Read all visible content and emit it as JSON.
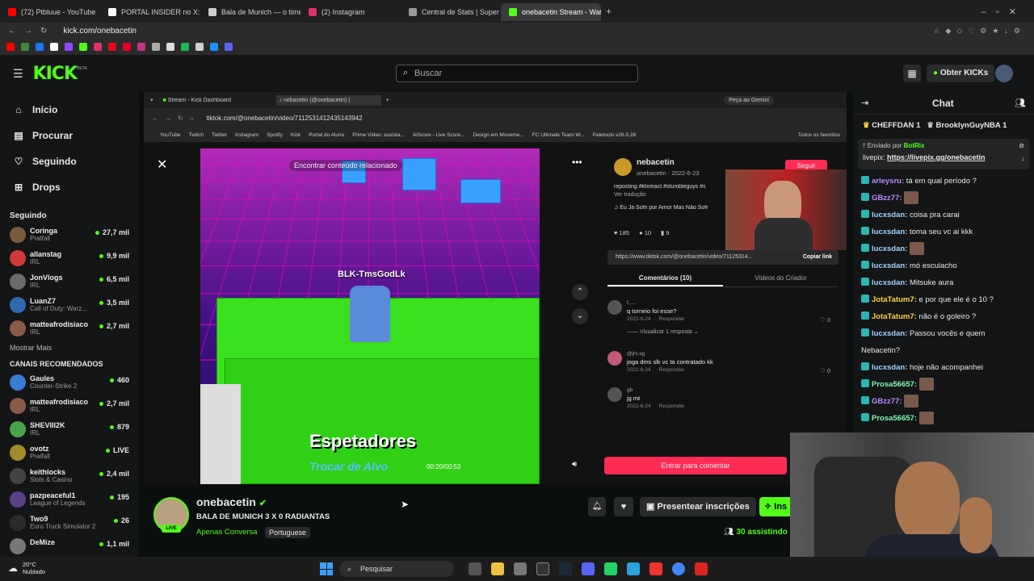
{
  "browser": {
    "tabs": [
      {
        "label": "(72) Ptbluue - YouTube",
        "color": "#ff0000"
      },
      {
        "label": "PORTAL INSIDER no X: \"",
        "color": "#ffffff"
      },
      {
        "label": "Bala de Munich — o time c",
        "color": "#cccccc"
      },
      {
        "label": "(2) Instagram",
        "color": "#e1306c"
      },
      {
        "label": "Central de Stats | Super Ce",
        "color": "#999999"
      },
      {
        "label": "onebacetin Stream - Watch",
        "color": "#53fc18"
      }
    ],
    "url": "kick.com/onebacetin"
  },
  "kick": {
    "logo": "KICK",
    "logo_beta": "BETA",
    "search_placeholder": "Buscar",
    "obtain_kicks": "Obter KICKs",
    "nav": [
      {
        "label": "Início",
        "icon": "home-icon"
      },
      {
        "label": "Procurar",
        "icon": "browse-icon"
      },
      {
        "label": "Seguindo",
        "icon": "heart-icon"
      },
      {
        "label": "Drops",
        "icon": "drops-icon"
      }
    ],
    "following_title": "Seguindo",
    "following": [
      {
        "name": "Coringa",
        "category": "Pratfall",
        "viewers": "27,7 mil",
        "color": "#7a5c3c"
      },
      {
        "name": "allanstag",
        "category": "IRL",
        "viewers": "9,9 mil",
        "color": "#d23a3a"
      },
      {
        "name": "JonVlogs",
        "category": "IRL",
        "viewers": "6,5 mil",
        "color": "#6b6b6b"
      },
      {
        "name": "LuanZ7",
        "category": "Call of Duty: Warz...",
        "viewers": "3,5 mil",
        "color": "#2f6ab0"
      },
      {
        "name": "matteafrodisiaco",
        "category": "IRL",
        "viewers": "2,7 mil",
        "color": "#8b5a4a"
      }
    ],
    "show_more": "Mostrar Mais",
    "recommended_title": "CANAIS RECOMENDADOS",
    "recommended": [
      {
        "name": "Gaules",
        "category": "Counter-Strike 2",
        "viewers": "460",
        "color": "#3a7bd5"
      },
      {
        "name": "matteafrodisiaco",
        "category": "IRL",
        "viewers": "2,7 mil",
        "color": "#8b5a4a"
      },
      {
        "name": "SHEVIII2K",
        "category": "IRL",
        "viewers": "879",
        "color": "#4aa34a"
      },
      {
        "name": "ovotz",
        "category": "Pratfall",
        "viewers": "LIVE",
        "color": "#a08a2a"
      },
      {
        "name": "keithlocks",
        "category": "Slots & Casino",
        "viewers": "2,4 mil",
        "color": "#444"
      },
      {
        "name": "pazpeaceful1",
        "category": "League of Legends",
        "viewers": "195",
        "color": "#5a3f8a"
      },
      {
        "name": "Two9",
        "category": "Euro Truck Simulator 2",
        "viewers": "26",
        "color": "#2b2b2b"
      },
      {
        "name": "DeMize",
        "category": "",
        "viewers": "1,1 mil",
        "color": "#777"
      }
    ]
  },
  "inner_browser": {
    "tabs": [
      "Stream - Kick Dashboard",
      "nebacetin (@onebacetin) |"
    ],
    "gemini": "Peça ao Gemini",
    "url": "tiktok.com/@onebacetin/video/7112531412435143942",
    "bookmarks": [
      "YouTube",
      "Twitch",
      "Twitter",
      "Instagram",
      "Spotify",
      "Kick",
      "Portal do Aluno",
      "Prime Video: assista...",
      "AiScore - Live Score...",
      "Design em Moveme...",
      "FC Ultimate Team W...",
      "Paletools v26.0.28"
    ],
    "all_favorites": "Todos os favoritos"
  },
  "tiktok": {
    "related": "Encontrar conteúdo relacionado",
    "gamer_tag": "BLK-TmsGodLk",
    "spectators": "Espetadores",
    "change_target": "Trocar de Alvo",
    "time": "00:20/00:53",
    "author": "nebacetin",
    "author_sub": "onebacetin · 2022-6-23",
    "follow": "Seguir",
    "caption": "reposting #ktxreact #stumbleguys #s",
    "translate": "Ver tradução",
    "music": "Eu Já Sofri por Amor Mas Não Sofr",
    "likes": "185",
    "comments_count": "10",
    "saves": "9",
    "link": "https://www.tiktok.com/@onebacetin/video/71125314...",
    "copy_link": "Copiar link",
    "tab_comments": "Comentários (10)",
    "tab_creator": "Vídeos do Criador",
    "comments": [
      {
        "user": "f.....",
        "text": "q torneio foi esse?",
        "date": "2022-6-24",
        "reply": "Responder",
        "likes": "0",
        "more": "Visualizar 1 resposta"
      },
      {
        "user": "@jrx.sg",
        "text": "joga dms slk vc ta contratado kk",
        "date": "2022-6-24",
        "reply": "Responder",
        "likes": "0"
      },
      {
        "user": "gb",
        "text": "jg mt",
        "date": "2022-6-24",
        "reply": "Responder",
        "likes": ""
      }
    ],
    "comment_login": "Entrar para comentar"
  },
  "stream": {
    "channel": "onebacetin",
    "title": "BALA DE MUNICH 3 X 0 RADIANTAS",
    "category": "Apenas Conversa",
    "language": "Portuguese",
    "gift_subs": "Presentear inscrições",
    "subscribe": "Ins",
    "viewers": "30",
    "viewers_label": "assistindo",
    "live": "LIVE"
  },
  "chat": {
    "title": "Chat",
    "top_gifters": [
      {
        "name": "CHEFFDAN",
        "count": "1"
      },
      {
        "name": "BrooklynGuyNBA",
        "count": "1"
      }
    ],
    "pinned_by_label": "Enviado por",
    "pinned_by_user": "BotRix",
    "pinned_text": "livepix:",
    "pinned_link": "https://livepix.gg/onebacetin",
    "messages": [
      {
        "user": "arleysru",
        "color": "#b98bff",
        "text": "tá em qual período ?"
      },
      {
        "user": "GBzz77",
        "color": "#b98bff",
        "text": "[emote]"
      },
      {
        "user": "lucxsdan",
        "color": "#9fd4ff",
        "text": "coisa pra carai"
      },
      {
        "user": "lucxsdan",
        "color": "#9fd4ff",
        "text": "toma seu vc ai kkk"
      },
      {
        "user": "lucxsdan",
        "color": "#9fd4ff",
        "text": "[emote]"
      },
      {
        "user": "lucxsdan",
        "color": "#9fd4ff",
        "text": "mó esculacho"
      },
      {
        "user": "lucxsdan",
        "color": "#9fd4ff",
        "text": "Mitsuke aura"
      },
      {
        "user": "JotaTatum7",
        "color": "#ffd43b",
        "text": "e por que ele é o 10 ?"
      },
      {
        "user": "JotaTatum7",
        "color": "#ffd43b",
        "text": "não é o goleiro ?"
      },
      {
        "user": "lucxsdan",
        "color": "#9fd4ff",
        "text": "Passou vocês e quem"
      },
      {
        "user": "",
        "color": "#e8e8e8",
        "text": "Nebacetin?"
      },
      {
        "user": "lucxsdan",
        "color": "#9fd4ff",
        "text": "hoje não acompanhei"
      },
      {
        "user": "Prosa56657",
        "color": "#7dffb0",
        "text": "[emote]"
      },
      {
        "user": "GBzz77",
        "color": "#b98bff",
        "text": "[emote]"
      },
      {
        "user": "Prosa56657",
        "color": "#7dffb0",
        "text": "[emote]"
      }
    ]
  },
  "taskbar": {
    "temp": "20°C",
    "weather": "Nublado",
    "search": "Pesquisar"
  },
  "colors": {
    "kick_green": "#53fc18",
    "tiktok_red": "#fe2c55"
  }
}
